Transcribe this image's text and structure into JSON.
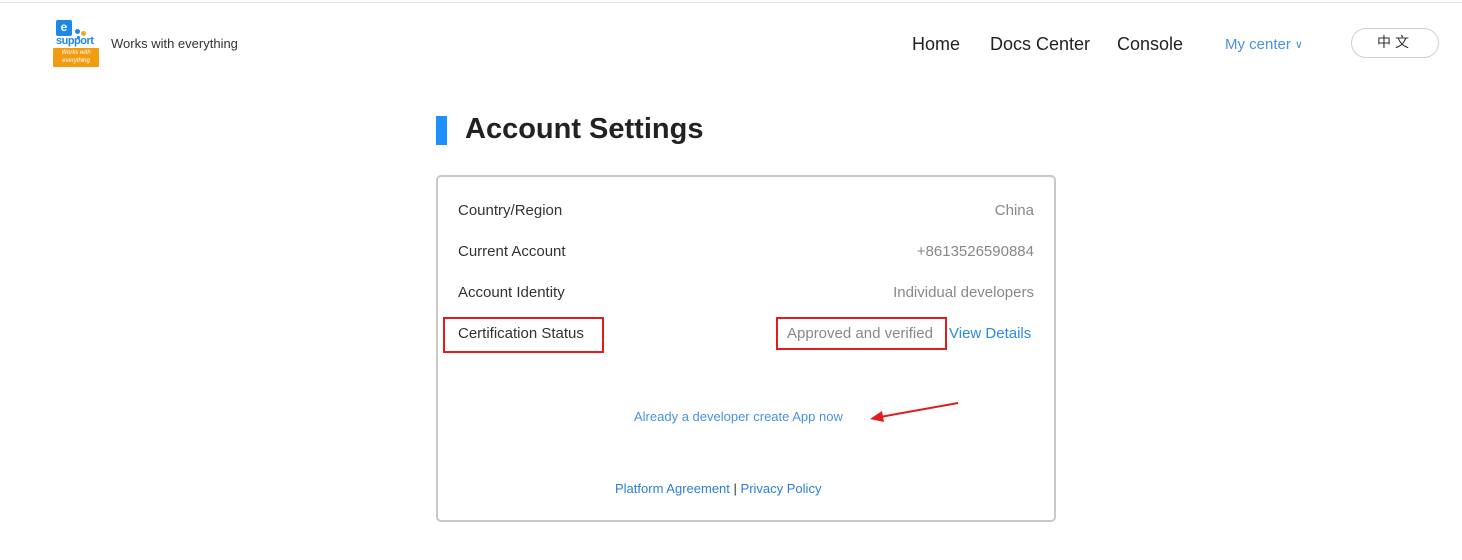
{
  "header": {
    "logo": {
      "letter": "e",
      "word": "support",
      "badge": "Works with everything"
    },
    "tagline": "Works with everything",
    "nav": {
      "home": "Home",
      "docs": "Docs Center",
      "console": "Console",
      "my_center": "My center",
      "my_center_chevron": "∨",
      "language": "中文"
    }
  },
  "page": {
    "title": "Account Settings",
    "accent_color": "#1e8fff"
  },
  "account": {
    "rows": [
      {
        "label": "Country/Region",
        "value": "China"
      },
      {
        "label": "Current Account",
        "value": "+8613526590884"
      },
      {
        "label": "Account Identity",
        "value": "Individual developers"
      },
      {
        "label": "Certification Status",
        "value": "Approved and verified"
      }
    ],
    "view_details": "View Details",
    "developer_link": "Already a developer create App now"
  },
  "footer": {
    "platform_agreement": "Platform Agreement",
    "separator": "|",
    "privacy_policy": "Privacy Policy"
  },
  "annotations": {
    "highlight_color": "#e01c1c"
  }
}
